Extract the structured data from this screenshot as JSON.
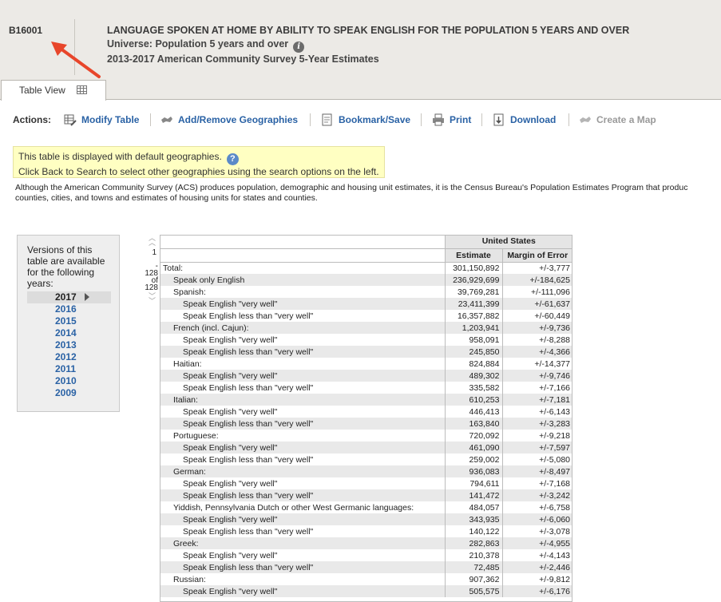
{
  "header": {
    "table_id": "B16001",
    "title": "LANGUAGE SPOKEN AT HOME BY ABILITY TO SPEAK ENGLISH FOR THE POPULATION 5 YEARS AND OVER",
    "universe": "Universe: Population 5 years and over",
    "survey": "2013-2017 American Community Survey 5-Year Estimates",
    "info_icon": "i"
  },
  "tab": {
    "label": "Table View",
    "icon": "grid-icon"
  },
  "actions": {
    "label": "Actions:",
    "items": [
      {
        "label": "Modify Table",
        "icon": "modify-table-icon"
      },
      {
        "label": "Add/Remove Geographies",
        "icon": "geographies-icon"
      },
      {
        "label": "Bookmark/Save",
        "icon": "bookmark-icon"
      },
      {
        "label": "Print",
        "icon": "print-icon"
      },
      {
        "label": "Download",
        "icon": "download-icon"
      },
      {
        "label": "Create a Map",
        "icon": "map-icon"
      }
    ]
  },
  "notice": {
    "line1": "This table is displayed with default geographies.",
    "line2": "Click Back to Search to select other geographies using the search options on the left.",
    "help": "?"
  },
  "description": {
    "line1": "Although the American Community Survey (ACS) produces population, demographic and housing unit estimates, it is the Census Bureau's Population Estimates Program that produc",
    "line2": "counties, cities, and towns and estimates of housing units for states and counties."
  },
  "versions": {
    "title": "Versions of this table are available for the following years:",
    "selected": "2017",
    "years": [
      "2016",
      "2015",
      "2014",
      "2013",
      "2012",
      "2011",
      "2010",
      "2009"
    ]
  },
  "pager": {
    "current": "1",
    "dash": "-",
    "end": "128",
    "of": "of",
    "total": "128"
  },
  "table": {
    "geography": "United States",
    "col_estimate": "Estimate",
    "col_moe": "Margin of Error",
    "rows": [
      {
        "label": "Total:",
        "level": 0,
        "estimate": "301,150,892",
        "moe": "+/-3,777"
      },
      {
        "label": "Speak only English",
        "level": 1,
        "estimate": "236,929,699",
        "moe": "+/-184,625"
      },
      {
        "label": "Spanish:",
        "level": 1,
        "estimate": "39,769,281",
        "moe": "+/-111,096"
      },
      {
        "label": "Speak English \"very well\"",
        "level": 2,
        "estimate": "23,411,399",
        "moe": "+/-61,637"
      },
      {
        "label": "Speak English less than \"very well\"",
        "level": 2,
        "estimate": "16,357,882",
        "moe": "+/-60,449"
      },
      {
        "label": "French (incl. Cajun):",
        "level": 1,
        "estimate": "1,203,941",
        "moe": "+/-9,736"
      },
      {
        "label": "Speak English \"very well\"",
        "level": 2,
        "estimate": "958,091",
        "moe": "+/-8,288"
      },
      {
        "label": "Speak English less than \"very well\"",
        "level": 2,
        "estimate": "245,850",
        "moe": "+/-4,366"
      },
      {
        "label": "Haitian:",
        "level": 1,
        "estimate": "824,884",
        "moe": "+/-14,377"
      },
      {
        "label": "Speak English \"very well\"",
        "level": 2,
        "estimate": "489,302",
        "moe": "+/-9,746"
      },
      {
        "label": "Speak English less than \"very well\"",
        "level": 2,
        "estimate": "335,582",
        "moe": "+/-7,166"
      },
      {
        "label": "Italian:",
        "level": 1,
        "estimate": "610,253",
        "moe": "+/-7,181"
      },
      {
        "label": "Speak English \"very well\"",
        "level": 2,
        "estimate": "446,413",
        "moe": "+/-6,143"
      },
      {
        "label": "Speak English less than \"very well\"",
        "level": 2,
        "estimate": "163,840",
        "moe": "+/-3,283"
      },
      {
        "label": "Portuguese:",
        "level": 1,
        "estimate": "720,092",
        "moe": "+/-9,218"
      },
      {
        "label": "Speak English \"very well\"",
        "level": 2,
        "estimate": "461,090",
        "moe": "+/-7,597"
      },
      {
        "label": "Speak English less than \"very well\"",
        "level": 2,
        "estimate": "259,002",
        "moe": "+/-5,080"
      },
      {
        "label": "German:",
        "level": 1,
        "estimate": "936,083",
        "moe": "+/-8,497"
      },
      {
        "label": "Speak English \"very well\"",
        "level": 2,
        "estimate": "794,611",
        "moe": "+/-7,168"
      },
      {
        "label": "Speak English less than \"very well\"",
        "level": 2,
        "estimate": "141,472",
        "moe": "+/-3,242"
      },
      {
        "label": "Yiddish, Pennsylvania Dutch or other West Germanic languages:",
        "level": 1,
        "estimate": "484,057",
        "moe": "+/-6,758"
      },
      {
        "label": "Speak English \"very well\"",
        "level": 2,
        "estimate": "343,935",
        "moe": "+/-6,060"
      },
      {
        "label": "Speak English less than \"very well\"",
        "level": 2,
        "estimate": "140,122",
        "moe": "+/-3,078"
      },
      {
        "label": "Greek:",
        "level": 1,
        "estimate": "282,863",
        "moe": "+/-4,955"
      },
      {
        "label": "Speak English \"very well\"",
        "level": 2,
        "estimate": "210,378",
        "moe": "+/-4,143"
      },
      {
        "label": "Speak English less than \"very well\"",
        "level": 2,
        "estimate": "72,485",
        "moe": "+/-2,446"
      },
      {
        "label": "Russian:",
        "level": 1,
        "estimate": "907,362",
        "moe": "+/-9,812"
      },
      {
        "label": "Speak English \"very well\"",
        "level": 2,
        "estimate": "505,575",
        "moe": "+/-6,176"
      }
    ]
  },
  "colors": {
    "link": "#2a62a5",
    "arrow": "#e8462b",
    "header_bg": "#eceae6",
    "notice_bg": "#ffffc2"
  }
}
